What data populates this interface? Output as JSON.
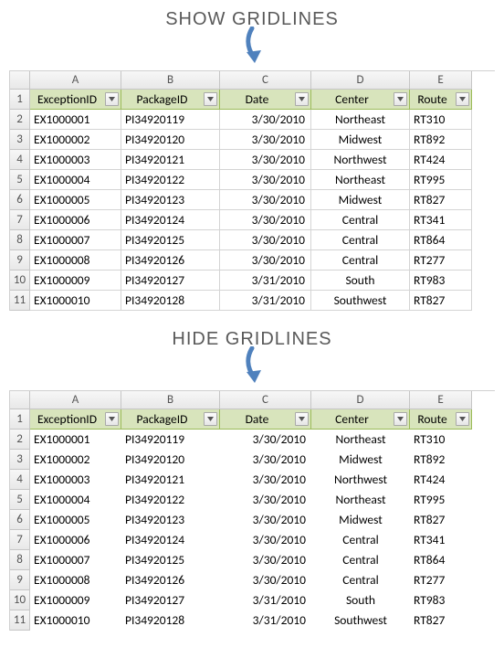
{
  "sections": [
    {
      "title": "SHOW GRIDLINES",
      "gridlines": true
    },
    {
      "title": "HIDE GRIDLINES",
      "gridlines": false
    }
  ],
  "columns": [
    "A",
    "B",
    "C",
    "D",
    "E"
  ],
  "rowNumbers": [
    "1",
    "2",
    "3",
    "4",
    "5",
    "6",
    "7",
    "8",
    "9",
    "10",
    "11"
  ],
  "headers": [
    "ExceptionID",
    "PackageID",
    "Date",
    "Center",
    "Route"
  ],
  "rows": [
    [
      "EX1000001",
      "PI34920119",
      "3/30/2010",
      "Northeast",
      "RT310"
    ],
    [
      "EX1000002",
      "PI34920120",
      "3/30/2010",
      "Midwest",
      "RT892"
    ],
    [
      "EX1000003",
      "PI34920121",
      "3/30/2010",
      "Northwest",
      "RT424"
    ],
    [
      "EX1000004",
      "PI34920122",
      "3/30/2010",
      "Northeast",
      "RT995"
    ],
    [
      "EX1000005",
      "PI34920123",
      "3/30/2010",
      "Midwest",
      "RT827"
    ],
    [
      "EX1000006",
      "PI34920124",
      "3/30/2010",
      "Central",
      "RT341"
    ],
    [
      "EX1000007",
      "PI34920125",
      "3/30/2010",
      "Central",
      "RT864"
    ],
    [
      "EX1000008",
      "PI34920126",
      "3/30/2010",
      "Central",
      "RT277"
    ],
    [
      "EX1000009",
      "PI34920127",
      "3/31/2010",
      "South",
      "RT983"
    ],
    [
      "EX1000010",
      "PI34920128",
      "3/31/2010",
      "Southwest",
      "RT827"
    ]
  ],
  "alignments": [
    "al-left",
    "al-left",
    "al-right",
    "al-center",
    "al-left"
  ],
  "accentColor": "#4f81bd"
}
